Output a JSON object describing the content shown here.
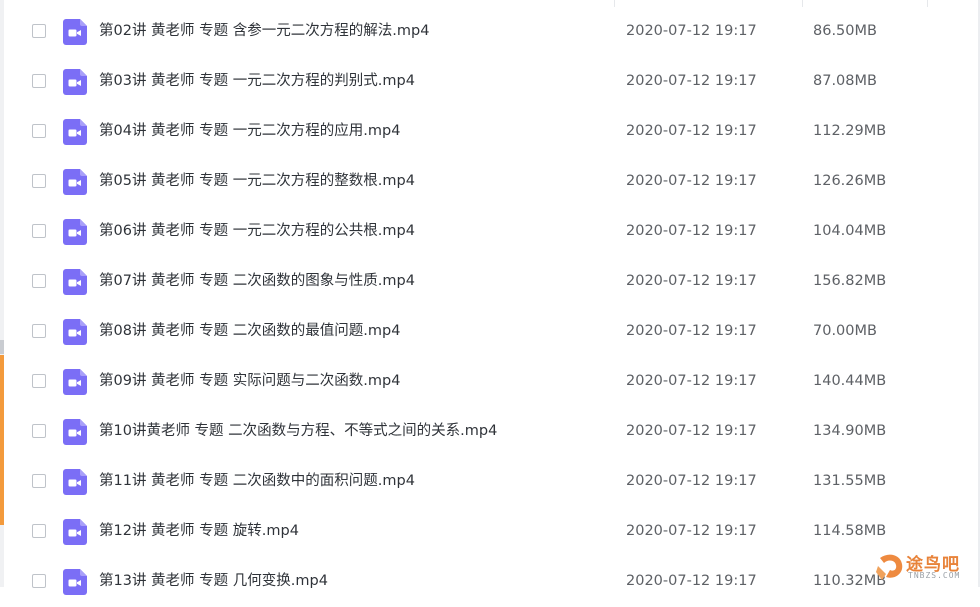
{
  "colors": {
    "video_icon": "#7b6ef6",
    "accent_orange": "#f39a3c"
  },
  "icons": {
    "file_type": "video-file-icon",
    "watermark": "watermark-logo-icon"
  },
  "files": [
    {
      "name": "第02讲 黄老师 专题 含参一元二次方程的解法.mp4",
      "time": "2020-07-12 19:17",
      "size": "86.50MB"
    },
    {
      "name": "第03讲 黄老师 专题 一元二次方程的判别式.mp4",
      "time": "2020-07-12 19:17",
      "size": "87.08MB"
    },
    {
      "name": "第04讲 黄老师 专题 一元二次方程的应用.mp4",
      "time": "2020-07-12 19:17",
      "size": "112.29MB"
    },
    {
      "name": "第05讲 黄老师 专题 一元二次方程的整数根.mp4",
      "time": "2020-07-12 19:17",
      "size": "126.26MB"
    },
    {
      "name": "第06讲 黄老师 专题 一元二次方程的公共根.mp4",
      "time": "2020-07-12 19:17",
      "size": "104.04MB"
    },
    {
      "name": "第07讲 黄老师 专题 二次函数的图象与性质.mp4",
      "time": "2020-07-12 19:17",
      "size": "156.82MB"
    },
    {
      "name": "第08讲 黄老师 专题 二次函数的最值问题.mp4",
      "time": "2020-07-12 19:17",
      "size": "70.00MB"
    },
    {
      "name": "第09讲 黄老师 专题 实际问题与二次函数.mp4",
      "time": "2020-07-12 19:17",
      "size": "140.44MB"
    },
    {
      "name": "第10讲黄老师 专题 二次函数与方程、不等式之间的关系.mp4",
      "time": "2020-07-12 19:17",
      "size": "134.90MB"
    },
    {
      "name": "第11讲 黄老师 专题 二次函数中的面积问题.mp4",
      "time": "2020-07-12 19:17",
      "size": "131.55MB"
    },
    {
      "name": "第12讲 黄老师 专题 旋转.mp4",
      "time": "2020-07-12 19:17",
      "size": "114.58MB"
    },
    {
      "name": "第13讲 黄老师 专题 几何变换.mp4",
      "time": "2020-07-12 19:17",
      "size": "110.32MB"
    }
  ],
  "watermark": {
    "text": "途鸟吧",
    "sub": "TNBZS.COM"
  }
}
